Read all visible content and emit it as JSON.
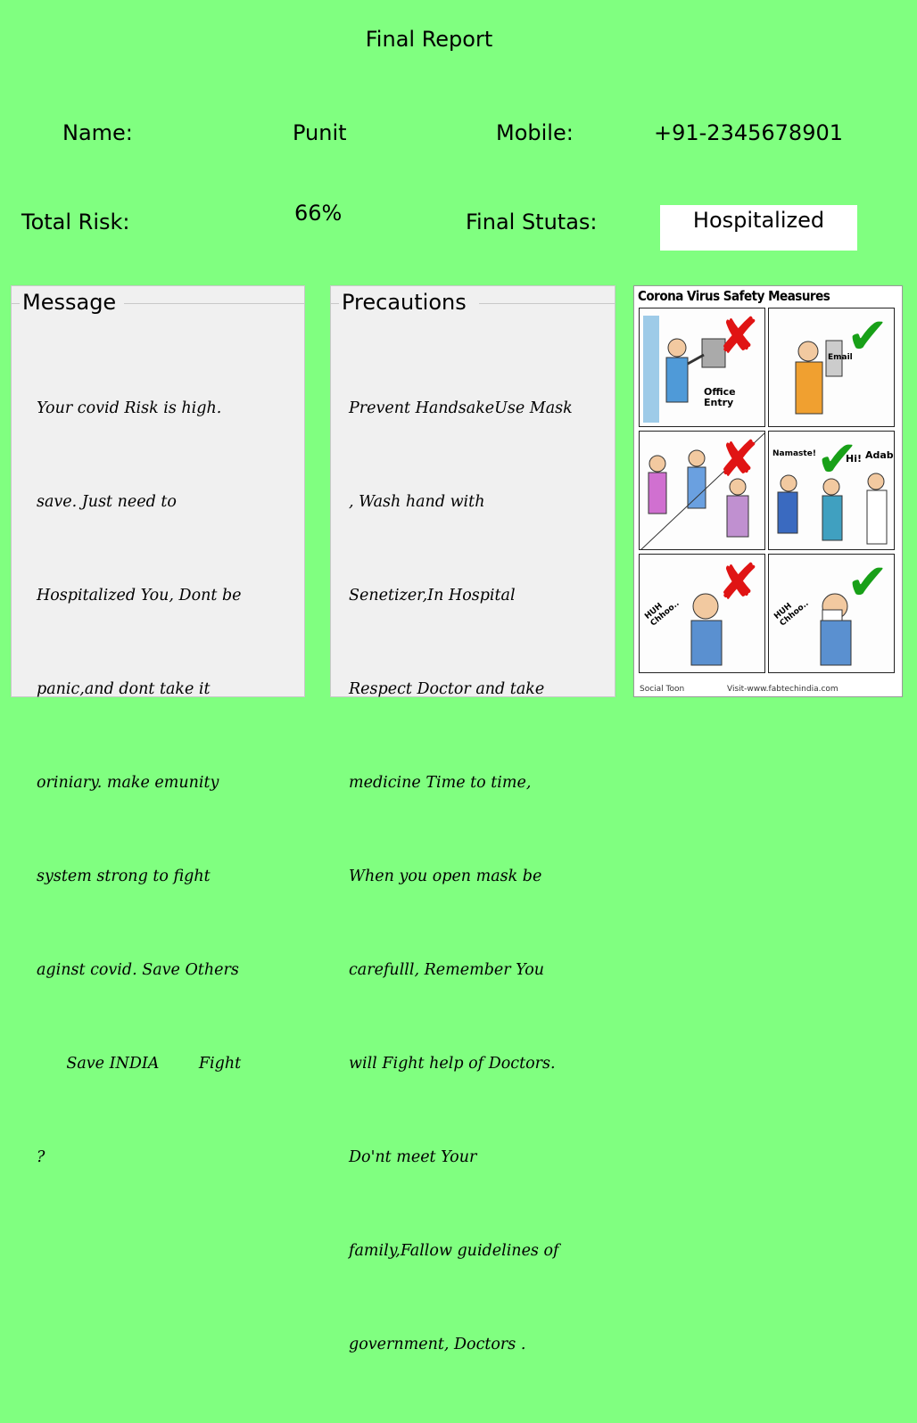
{
  "title": "Final Report",
  "name_label": "Name:",
  "name_value": "Punit",
  "mobile_label": "Mobile:",
  "mobile_value": "+91-2345678901",
  "risk_label": "Total Risk:",
  "risk_value": "66%",
  "status_label": "Final Stutas:",
  "status_value": "Hospitalized",
  "message": {
    "title": "Message",
    "lines": [
      "Your covid Risk is high.",
      "save. Just need to",
      "Hospitalized You, Dont be",
      "panic,and dont take it",
      "oriniary. make emunity",
      "system strong to fight",
      "aginst covid. Save Others",
      "      Save INDIA        Fight",
      "?"
    ]
  },
  "precautions": {
    "title": "Precautions",
    "lines": [
      "Prevent HandsakeUse Mask",
      ", Wash hand with",
      "Senetizer,In Hospital",
      "Respect Doctor and take",
      "medicine Time to time,",
      "When you open mask be",
      "carefulll, Remember You",
      "will Fight help of Doctors.",
      "Do'nt meet Your",
      "family,Fallow guidelines of",
      "government, Doctors ."
    ]
  },
  "poster": {
    "title": "Corona Virus Safety Measures",
    "cell1_text": "Office Entry",
    "cell2_text": "Email",
    "cell4_left": "Namaste!",
    "cell4_mid": "Hi!",
    "cell4_right": "Adab!",
    "cell5_text": "HUH Chhoo..",
    "cell6_text": "HUH Chhoo..",
    "footer_left": "Social Toon",
    "footer_mid": "Visit-www.fabtechindia.com",
    "colors": {
      "cross": "#e01414",
      "check": "#18a018"
    }
  }
}
